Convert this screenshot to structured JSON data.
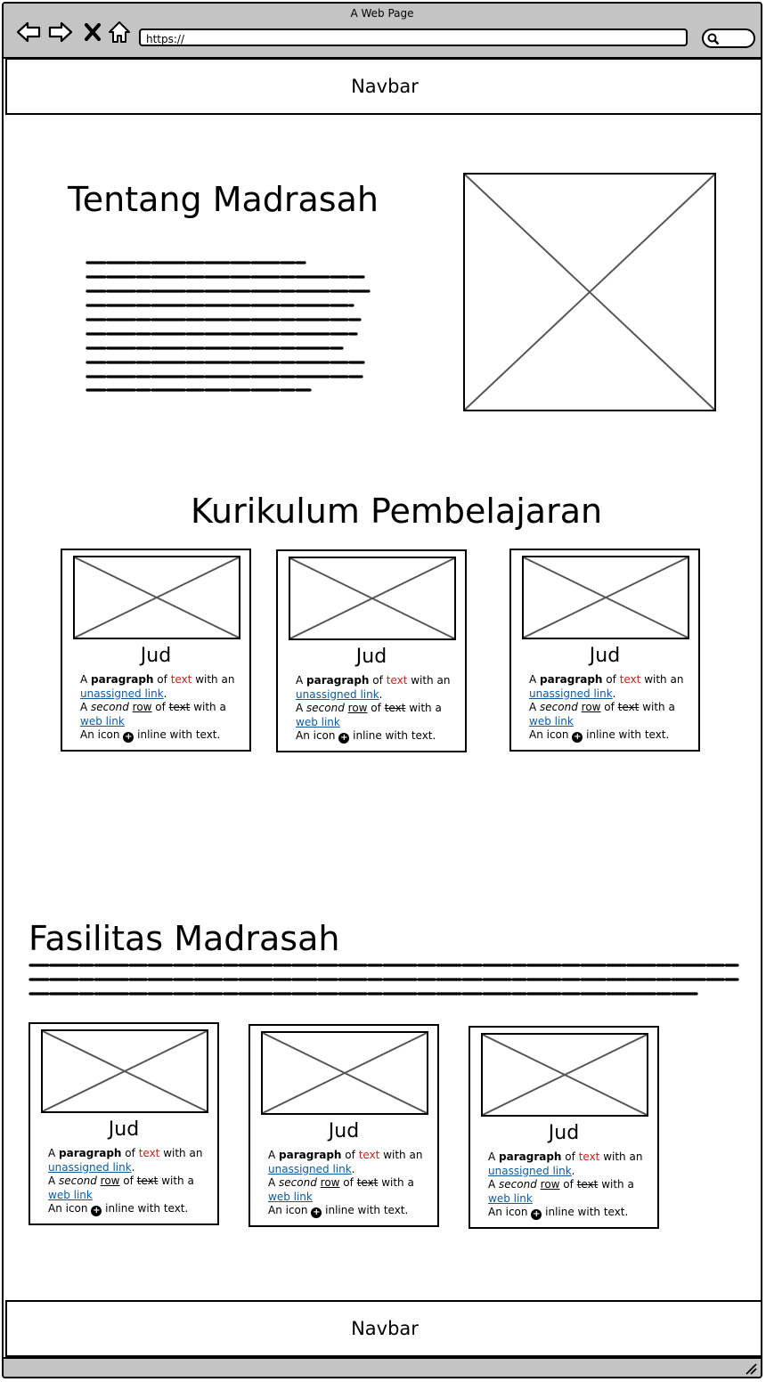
{
  "window": {
    "title": "A Web Page",
    "url": "https://"
  },
  "header_nav": {
    "label": "Navbar"
  },
  "footer_nav": {
    "label": "Navbar"
  },
  "about": {
    "heading": "Tentang Madrasah"
  },
  "curriculum": {
    "heading": "Kurikulum Pembelajaran",
    "cards": [
      {
        "title": "Jud",
        "a": "A ",
        "paragraph": "paragraph",
        "of": " of ",
        "text": "text",
        "with_an": " with an",
        "unassigned_link": "unassigned link",
        "period": ".",
        "a2": "A ",
        "second": "second",
        "space": " ",
        "row": "row",
        "of2": " of ",
        "text2": "text",
        "with_a": " with a",
        "web_link": "web link",
        "icon_pre": "An icon ",
        "icon_post": " inline with text."
      },
      {
        "title": "Jud",
        "a": "A ",
        "paragraph": "paragraph",
        "of": " of ",
        "text": "text",
        "with_an": " with an",
        "unassigned_link": "unassigned link",
        "period": ".",
        "a2": "A ",
        "second": "second",
        "space": " ",
        "row": "row",
        "of2": " of ",
        "text2": "text",
        "with_a": " with a",
        "web_link": "web link",
        "icon_pre": "An icon ",
        "icon_post": " inline with text."
      },
      {
        "title": "Jud",
        "a": "A ",
        "paragraph": "paragraph",
        "of": " of ",
        "text": "text",
        "with_an": " with an",
        "unassigned_link": "unassigned link",
        "period": ".",
        "a2": "A ",
        "second": "second",
        "space": " ",
        "row": "row",
        "of2": " of ",
        "text2": "text",
        "with_a": " with a",
        "web_link": "web link",
        "icon_pre": "An icon ",
        "icon_post": " inline with text."
      }
    ]
  },
  "facilities": {
    "heading": "Fasilitas Madrasah",
    "cards": [
      {
        "title": "Jud",
        "a": "A ",
        "paragraph": "paragraph",
        "of": " of ",
        "text": "text",
        "with_an": " with an",
        "unassigned_link": "unassigned link",
        "period": ".",
        "a2": "A ",
        "second": "second",
        "space": " ",
        "row": "row",
        "of2": " of ",
        "text2": "text",
        "with_a": " with a",
        "web_link": "web link",
        "icon_pre": "An icon ",
        "icon_post": " inline with text."
      },
      {
        "title": "Jud",
        "a": "A ",
        "paragraph": "paragraph",
        "of": " of ",
        "text": "text",
        "with_an": " with an",
        "unassigned_link": "unassigned link",
        "period": ".",
        "a2": "A ",
        "second": "second",
        "space": " ",
        "row": "row",
        "of2": " of ",
        "text2": "text",
        "with_a": " with a",
        "web_link": "web link",
        "icon_pre": "An icon ",
        "icon_post": " inline with text."
      },
      {
        "title": "Jud",
        "a": "A ",
        "paragraph": "paragraph",
        "of": " of ",
        "text": "text",
        "with_an": " with an",
        "unassigned_link": "unassigned link",
        "period": ".",
        "a2": "A ",
        "second": "second",
        "space": " ",
        "row": "row",
        "of2": " of ",
        "text2": "text",
        "with_a": " with a",
        "web_link": "web link",
        "icon_pre": "An icon ",
        "icon_post": " inline with text."
      }
    ]
  },
  "colors": {
    "chrome": "#c4c4c4",
    "link": "#0e5a9c",
    "accent_text": "#c0271e"
  },
  "icons": [
    "back-arrow-icon",
    "forward-arrow-icon",
    "close-icon",
    "home-icon",
    "search-icon",
    "plus-circle-icon",
    "resize-grip-icon"
  ]
}
